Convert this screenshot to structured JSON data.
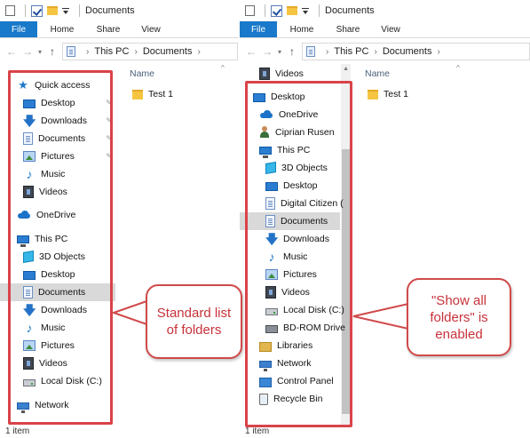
{
  "left": {
    "titlebar": {
      "title": "Documents"
    },
    "ribbon": {
      "tabs": [
        "File",
        "Home",
        "Share",
        "View"
      ]
    },
    "address": {
      "crumbs": [
        "This PC",
        "Documents"
      ]
    },
    "nav": [
      {
        "label": "Quick access",
        "icon": "star-icon"
      },
      {
        "label": "Desktop",
        "icon": "desktop-icon",
        "pinned": true
      },
      {
        "label": "Downloads",
        "icon": "download-icon",
        "pinned": true
      },
      {
        "label": "Documents",
        "icon": "documents-icon",
        "pinned": true
      },
      {
        "label": "Pictures",
        "icon": "pictures-icon",
        "pinned": true
      },
      {
        "label": "Music",
        "icon": "music-icon"
      },
      {
        "label": "Videos",
        "icon": "videos-icon"
      },
      {
        "label": "OneDrive",
        "icon": "onedrive-icon"
      },
      {
        "label": "This PC",
        "icon": "this-pc-icon"
      },
      {
        "label": "3D Objects",
        "icon": "3d-objects-icon"
      },
      {
        "label": "Desktop",
        "icon": "desktop-icon"
      },
      {
        "label": "Documents",
        "icon": "documents-icon",
        "selected": true
      },
      {
        "label": "Downloads",
        "icon": "download-icon"
      },
      {
        "label": "Music",
        "icon": "music-icon"
      },
      {
        "label": "Pictures",
        "icon": "pictures-icon"
      },
      {
        "label": "Videos",
        "icon": "videos-icon"
      },
      {
        "label": "Local Disk (C:)",
        "icon": "local-disk-icon"
      },
      {
        "label": "Network",
        "icon": "network-icon"
      }
    ],
    "content": {
      "column": "Name",
      "files": [
        "Test 1"
      ]
    },
    "status": "1 item"
  },
  "right": {
    "titlebar": {
      "title": "Documents"
    },
    "ribbon": {
      "tabs": [
        "File",
        "Home",
        "Share",
        "View"
      ]
    },
    "address": {
      "crumbs": [
        "This PC",
        "Documents"
      ]
    },
    "nav": [
      {
        "label": "Videos",
        "icon": "videos-icon"
      },
      {
        "label": "Desktop",
        "icon": "desktop-icon"
      },
      {
        "label": "OneDrive",
        "icon": "onedrive-icon"
      },
      {
        "label": "Ciprian Rusen",
        "icon": "user-icon"
      },
      {
        "label": "This PC",
        "icon": "this-pc-icon"
      },
      {
        "label": "3D Objects",
        "icon": "3d-objects-icon"
      },
      {
        "label": "Desktop",
        "icon": "desktop-icon"
      },
      {
        "label": "Digital Citizen (",
        "icon": "documents-icon"
      },
      {
        "label": "Documents",
        "icon": "documents-icon",
        "selected": true
      },
      {
        "label": "Downloads",
        "icon": "download-icon"
      },
      {
        "label": "Music",
        "icon": "music-icon"
      },
      {
        "label": "Pictures",
        "icon": "pictures-icon"
      },
      {
        "label": "Videos",
        "icon": "videos-icon"
      },
      {
        "label": "Local Disk (C:)",
        "icon": "local-disk-icon"
      },
      {
        "label": "BD-ROM Drive",
        "icon": "bd-rom-icon"
      },
      {
        "label": "Libraries",
        "icon": "libraries-icon"
      },
      {
        "label": "Network",
        "icon": "network-icon"
      },
      {
        "label": "Control Panel",
        "icon": "control-panel-icon"
      },
      {
        "label": "Recycle Bin",
        "icon": "recycle-bin-icon"
      }
    ],
    "content": {
      "column": "Name",
      "files": [
        "Test 1"
      ]
    },
    "status": "1 item"
  },
  "callouts": {
    "left": "Standard list of folders",
    "right": "\"Show all folders\" is enabled"
  },
  "colors": {
    "accent": "#1979ca",
    "annotation": "#d9434a",
    "selected": "#d9d9d9"
  }
}
